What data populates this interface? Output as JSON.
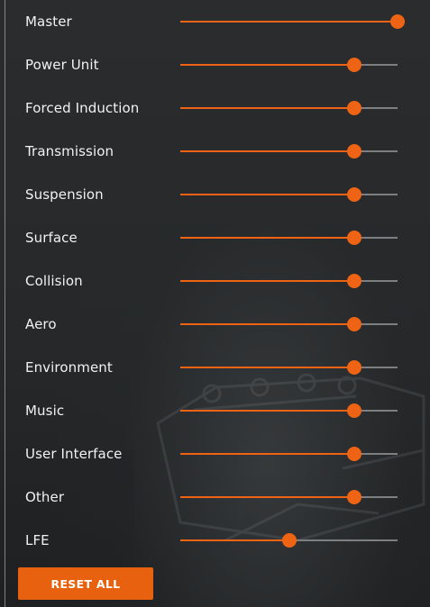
{
  "colors": {
    "accent": "#ef6414",
    "track": "#7d8083",
    "background": "#26282a",
    "text": "#f2f2f2"
  },
  "sliders": [
    {
      "label": "Master",
      "value": 1.0
    },
    {
      "label": "Power Unit",
      "value": 0.8
    },
    {
      "label": "Forced Induction",
      "value": 0.8
    },
    {
      "label": "Transmission",
      "value": 0.8
    },
    {
      "label": "Suspension",
      "value": 0.8
    },
    {
      "label": "Surface",
      "value": 0.8
    },
    {
      "label": "Collision",
      "value": 0.8
    },
    {
      "label": "Aero",
      "value": 0.8
    },
    {
      "label": "Environment",
      "value": 0.8
    },
    {
      "label": "Music",
      "value": 0.8
    },
    {
      "label": "User Interface",
      "value": 0.8
    },
    {
      "label": "Other",
      "value": 0.8
    },
    {
      "label": "LFE",
      "value": 0.5
    }
  ],
  "reset_button": {
    "label": "RESET ALL"
  }
}
